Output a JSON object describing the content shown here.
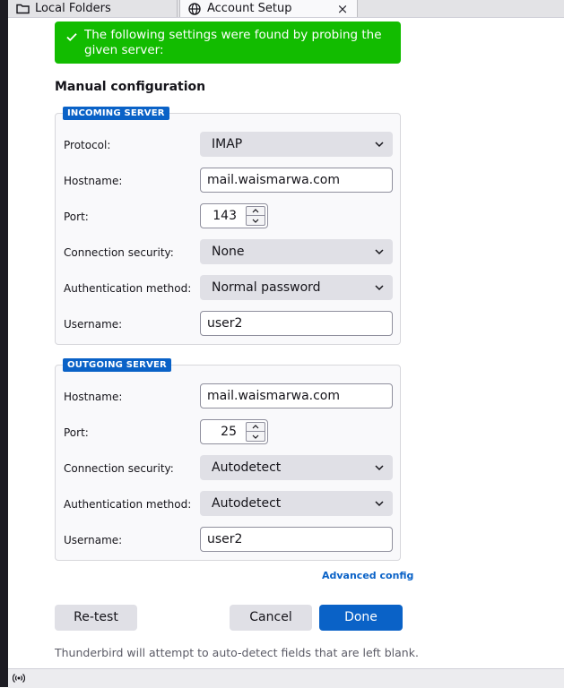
{
  "tabs": [
    {
      "label": "Local Folders",
      "icon": "folder-icon"
    },
    {
      "label": "Account Setup",
      "icon": "globe-icon",
      "close": "×"
    }
  ],
  "notice": {
    "text": "The following settings were found by probing the given server:",
    "color": "#12bc00"
  },
  "section_title": "Manual configuration",
  "incoming": {
    "legend": "INCOMING SERVER",
    "protocol_label": "Protocol:",
    "protocol_value": "IMAP",
    "hostname_label": "Hostname:",
    "hostname_value": "mail.waismarwa.com",
    "port_label": "Port:",
    "port_value": "143",
    "security_label": "Connection security:",
    "security_value": "None",
    "auth_label": "Authentication method:",
    "auth_value": "Normal password",
    "username_label": "Username:",
    "username_value": "user2"
  },
  "outgoing": {
    "legend": "OUTGOING SERVER",
    "hostname_label": "Hostname:",
    "hostname_value": "mail.waismarwa.com",
    "port_label": "Port:",
    "port_value": "25",
    "security_label": "Connection security:",
    "security_value": "Autodetect",
    "auth_label": "Authentication method:",
    "auth_value": "Autodetect",
    "username_label": "Username:",
    "username_value": "user2"
  },
  "advanced_config": "Advanced config",
  "buttons": {
    "retest": "Re-test",
    "cancel": "Cancel",
    "done": "Done"
  },
  "footnote": "Thunderbird will attempt to auto-detect fields that are left blank.",
  "colors": {
    "accent": "#0a62c7",
    "success": "#12bc00"
  }
}
